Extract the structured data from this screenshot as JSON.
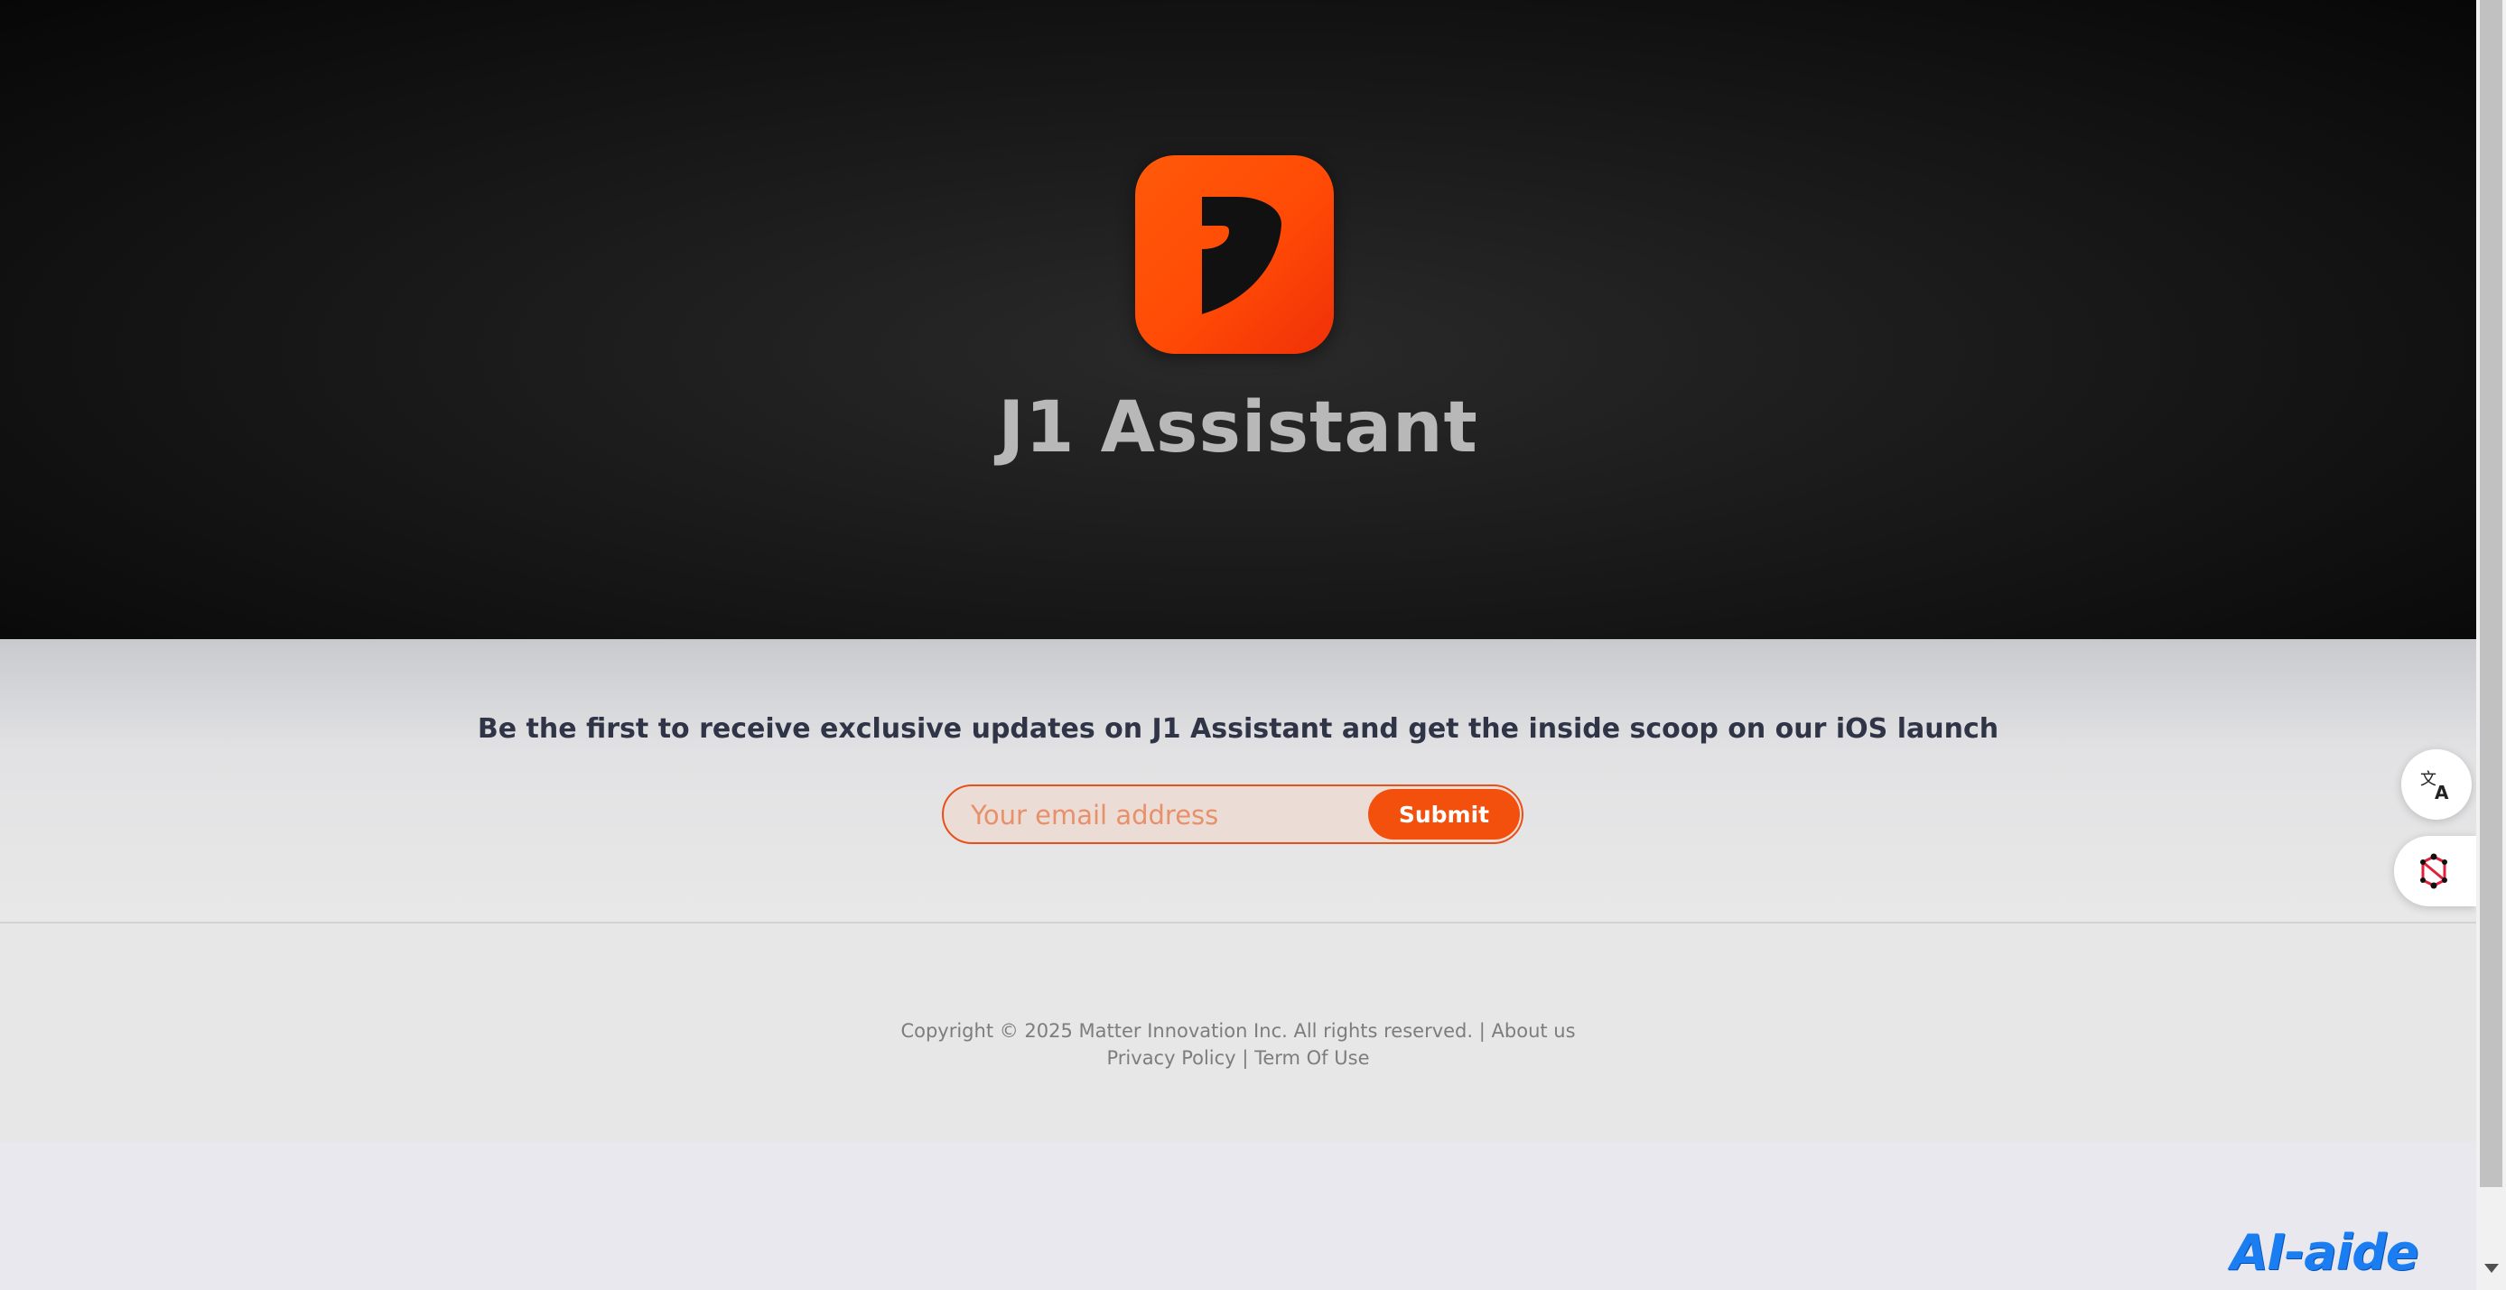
{
  "hero": {
    "app_title": "J1 Assistant",
    "logo_icon": "j1-logo-icon",
    "logo_color": "#ff4a05"
  },
  "subscribe": {
    "tagline": "Be the first to receive exclusive updates on J1 Assistant and get the inside scoop on our iOS launch",
    "email_placeholder": "Your email address",
    "submit_label": "Submit",
    "accent_color": "#f2500c"
  },
  "footer": {
    "copyright": "Copyright © 2025 Matter Innovation Inc. All rights reserved.",
    "sep1": "|",
    "about_label": "About us",
    "privacy_label": "Privacy Policy",
    "sep2": "|",
    "terms_label": "Term Of Use"
  },
  "widgets": {
    "translate_icon": "translate-icon",
    "network_icon": "network-icon",
    "brand_label": "AI-aide"
  }
}
